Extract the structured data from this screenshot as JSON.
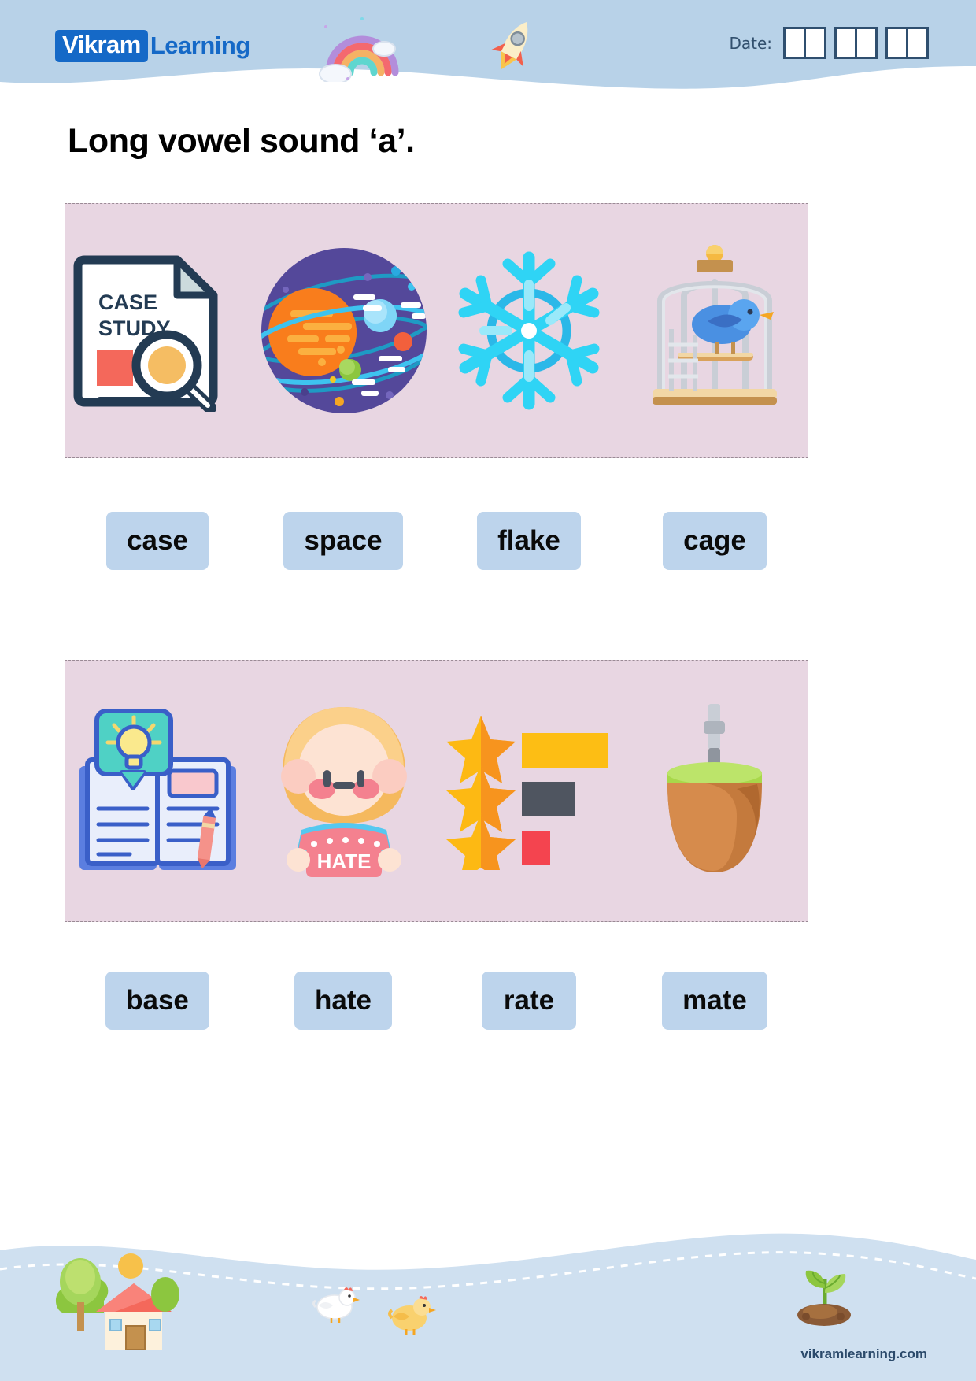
{
  "header": {
    "logo_mark": "Vikram",
    "logo_word": "Learning",
    "date_label": "Date:",
    "date_groups": 3,
    "date_cells_per_group": 2,
    "icons": [
      "rainbow-icon",
      "rocket-icon"
    ],
    "bg_color": "#b8d2e8"
  },
  "title": "Long vowel sound ‘a’.",
  "colors": {
    "panel_bg": "#e8d6e2",
    "panel_border": "#9a8a95",
    "word_box_bg": "#bdd4ec",
    "brand_blue": "#1569c7",
    "header_blue": "#b8d2e8",
    "text_dark": "#2b4a6b"
  },
  "exercises": [
    {
      "panel_id": 1,
      "pictures": [
        {
          "name": "case-study-document-icon",
          "caption_text": "CASE STUDY"
        },
        {
          "name": "space-planets-icon",
          "caption_text": ""
        },
        {
          "name": "snowflake-icon",
          "caption_text": ""
        },
        {
          "name": "birdcage-icon",
          "caption_text": ""
        }
      ],
      "words": [
        "case",
        "space",
        "flake",
        "cage"
      ]
    },
    {
      "panel_id": 2,
      "pictures": [
        {
          "name": "knowledge-base-book-icon",
          "caption_text": ""
        },
        {
          "name": "girl-hate-sign-icon",
          "caption_text": "HATE"
        },
        {
          "name": "star-rating-icon",
          "caption_text": ""
        },
        {
          "name": "mate-gourd-icon",
          "caption_text": ""
        }
      ],
      "words": [
        "base",
        "hate",
        "rate",
        "mate"
      ]
    }
  ],
  "footer": {
    "url": "vikramlearning.com",
    "icons": [
      "house-tree-icon",
      "chicken-icon",
      "chicken-icon",
      "plant-sprout-icon"
    ]
  }
}
